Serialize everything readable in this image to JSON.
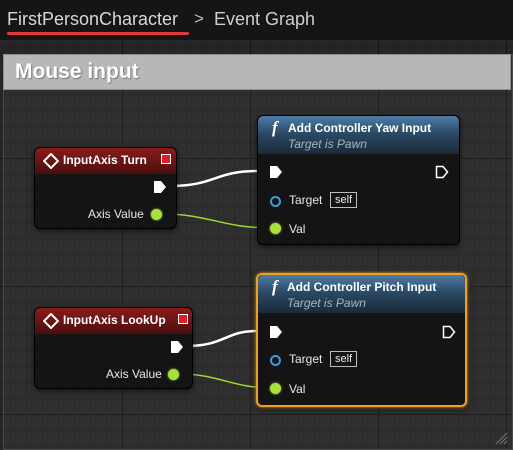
{
  "breadcrumb": {
    "root": "FirstPersonCharacter",
    "separator": ">",
    "current": "Event Graph"
  },
  "comment": {
    "title": "Mouse input"
  },
  "nodes": {
    "turn": {
      "title": "InputAxis Turn",
      "out_label": "Axis Value"
    },
    "yaw": {
      "title": "Add Controller Yaw Input",
      "subtitle": "Target is Pawn",
      "target_label": "Target",
      "target_value": "self",
      "val_label": "Val"
    },
    "lookup": {
      "title": "InputAxis LookUp",
      "out_label": "Axis Value"
    },
    "pitch": {
      "title": "Add Controller Pitch Input",
      "subtitle": "Target is Pawn",
      "target_label": "Target",
      "target_value": "self",
      "val_label": "Val"
    }
  },
  "colors": {
    "event_header": "#8a1b1b",
    "function_header": "#4f7ca8",
    "selected_outline": "#f0a020",
    "float_pin": "#a8e03c",
    "object_pin": "#3f9bd9",
    "breadcrumb_underline": "#e5383b"
  },
  "icons": [
    "event-diamond-icon",
    "delegate-pin-icon",
    "function-icon",
    "exec-pin-icon",
    "object-pin-icon",
    "float-pin-icon",
    "resize-grip-icon"
  ]
}
